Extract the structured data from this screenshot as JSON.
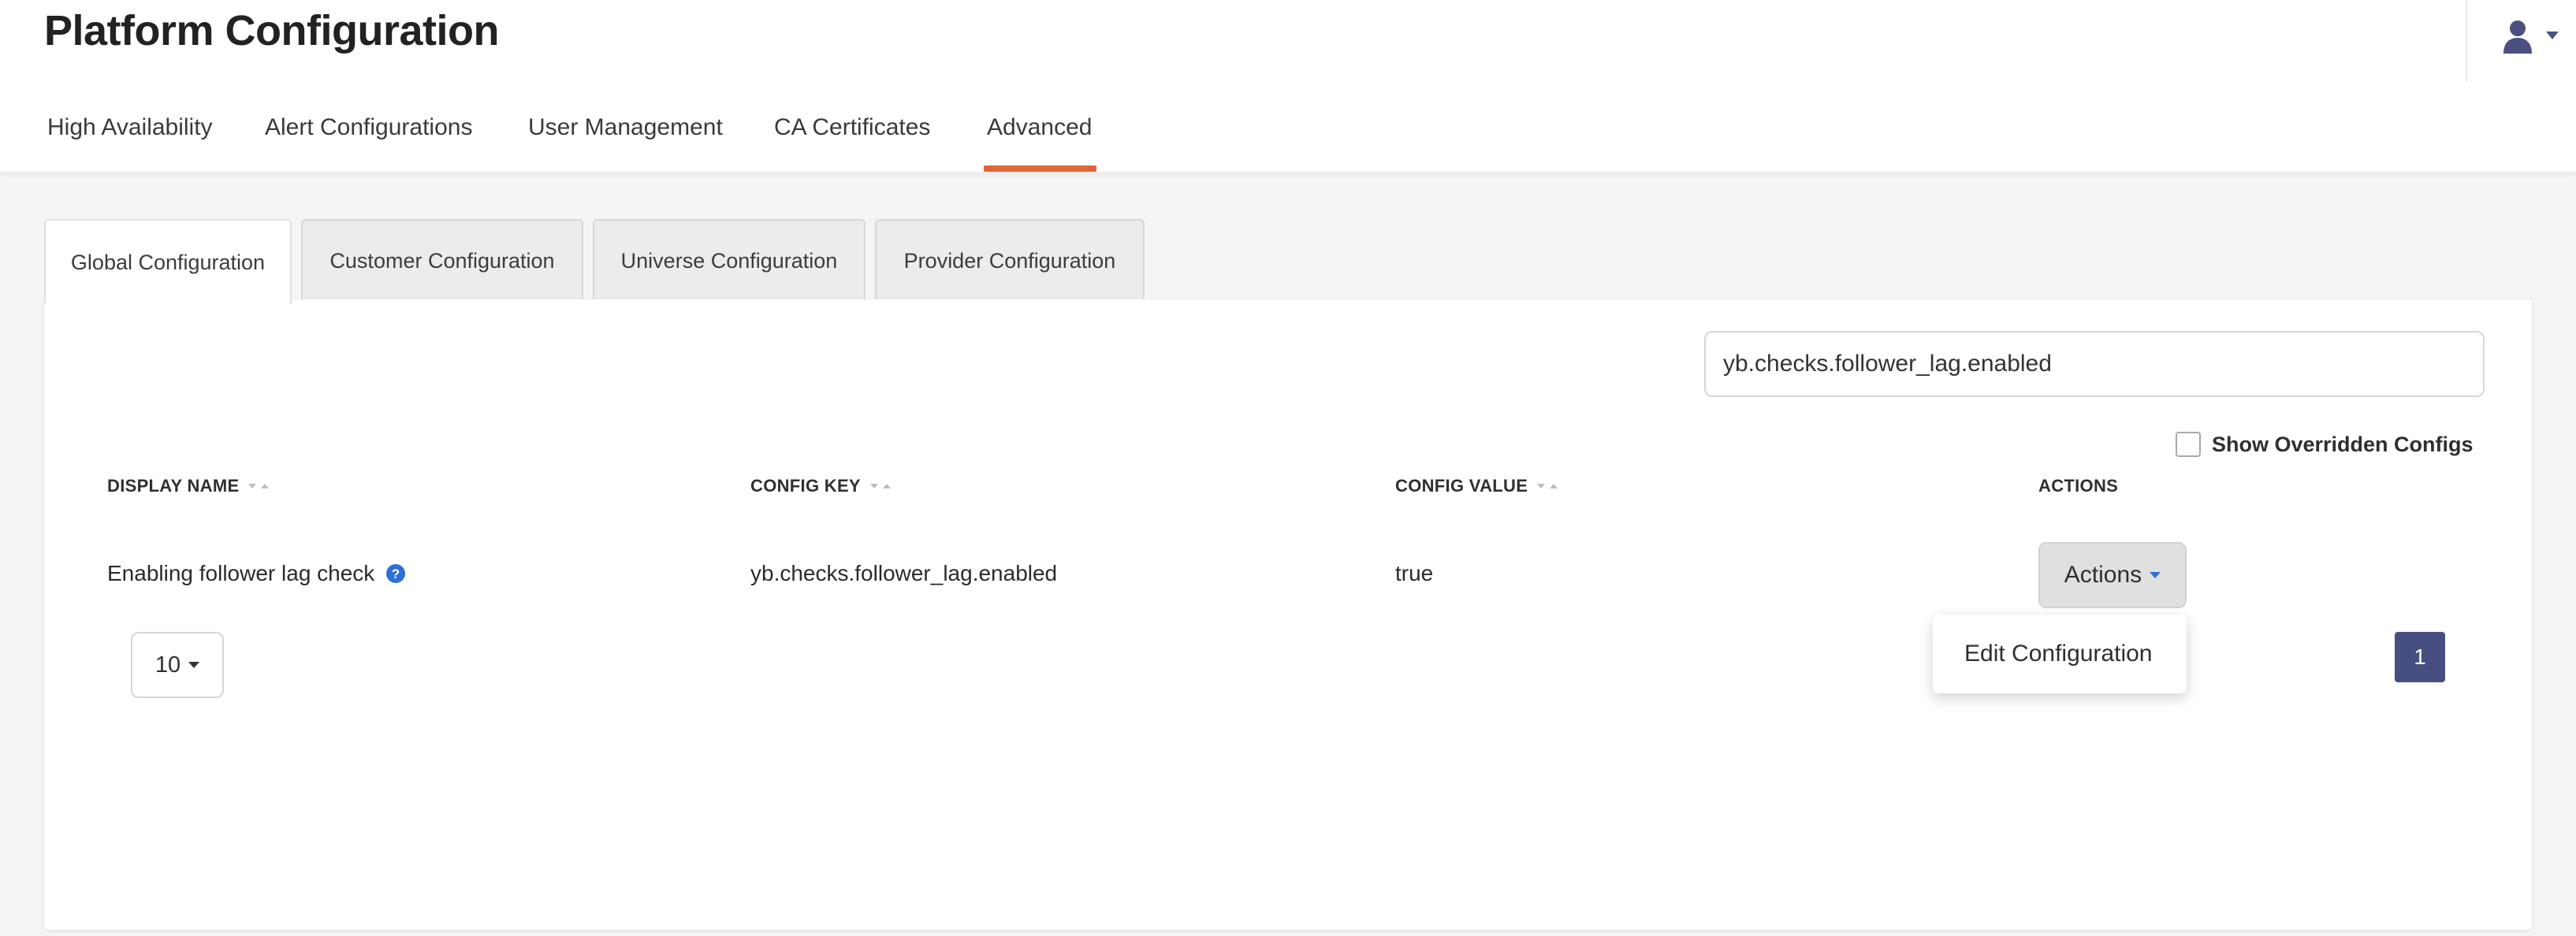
{
  "header": {
    "title": "Platform Configuration",
    "tabs": [
      {
        "label": "High Availability"
      },
      {
        "label": "Alert Configurations"
      },
      {
        "label": "User Management"
      },
      {
        "label": "CA Certificates"
      },
      {
        "label": "Advanced",
        "active": true
      }
    ],
    "user_icon": "user-icon"
  },
  "sub_tabs": [
    {
      "label": "Global Configuration",
      "active": true
    },
    {
      "label": "Customer Configuration"
    },
    {
      "label": "Universe Configuration"
    },
    {
      "label": "Provider Configuration"
    }
  ],
  "search": {
    "value": "yb.checks.follower_lag.enabled"
  },
  "overridden": {
    "label": "Show Overridden Configs",
    "checked": false
  },
  "table": {
    "columns": [
      "DISPLAY NAME",
      "CONFIG KEY",
      "CONFIG VALUE",
      "ACTIONS"
    ],
    "rows": [
      {
        "display_name": "Enabling follower lag check",
        "config_key": "yb.checks.follower_lag.enabled",
        "config_value": "true",
        "actions_label": "Actions"
      }
    ]
  },
  "actions_menu": {
    "items": [
      "Edit Configuration"
    ]
  },
  "pagination": {
    "page_size": "10",
    "current_page": "1"
  },
  "colors": {
    "accent": "#e0673a",
    "pagination_active": "#474f82",
    "help_icon": "#2f6fd6",
    "user_icon": "#4a5180"
  }
}
